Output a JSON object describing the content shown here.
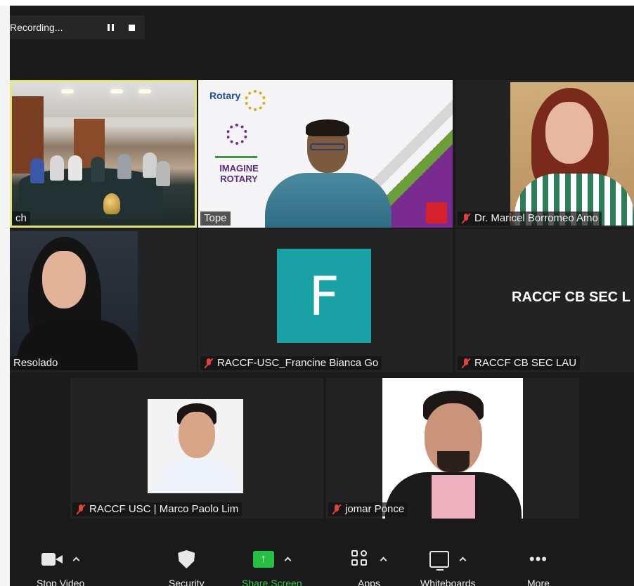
{
  "recording": {
    "status_text": "Recording..."
  },
  "participants": [
    {
      "name": "ch",
      "muted": false,
      "active_speaker": true,
      "kind": "video"
    },
    {
      "name": "Tope",
      "muted": false,
      "active_speaker": false,
      "kind": "video"
    },
    {
      "name": "Dr. Maricel Borromeo Amo",
      "muted": true,
      "active_speaker": false,
      "kind": "video"
    },
    {
      "name": "Resolado",
      "muted": false,
      "active_speaker": false,
      "kind": "video"
    },
    {
      "name": "RACCF-USC_Francine Bianca Go",
      "muted": true,
      "active_speaker": false,
      "kind": "avatar",
      "avatar_letter": "F",
      "avatar_color": "#1aa1a6"
    },
    {
      "name": "RACCF CB SEC LAU",
      "muted": true,
      "active_speaker": false,
      "kind": "name",
      "center_text": "RACCF CB SEC L"
    },
    {
      "name": "RACCF USC | Marco Paolo Lim",
      "muted": true,
      "active_speaker": false,
      "kind": "video"
    },
    {
      "name": "jomar Ponce",
      "muted": true,
      "active_speaker": false,
      "kind": "video"
    }
  ],
  "slide": {
    "rotary_title": "Rotary",
    "tagline_1": "IMAGINE",
    "tagline_2": "ROTARY"
  },
  "toolbar": {
    "items": [
      {
        "label": "Stop Video",
        "icon": "camera-icon"
      },
      {
        "label": "Security",
        "icon": "shield-icon"
      },
      {
        "label": "Share Screen",
        "icon": "share-screen-icon"
      },
      {
        "label": "Apps",
        "icon": "apps-icon"
      },
      {
        "label": "Whiteboards",
        "icon": "whiteboard-icon"
      },
      {
        "label": "More",
        "icon": "more-icon"
      }
    ]
  },
  "colors": {
    "active_speaker_border": "#e3e67b",
    "share_green": "#25c043",
    "muted_red": "#e2423c"
  }
}
